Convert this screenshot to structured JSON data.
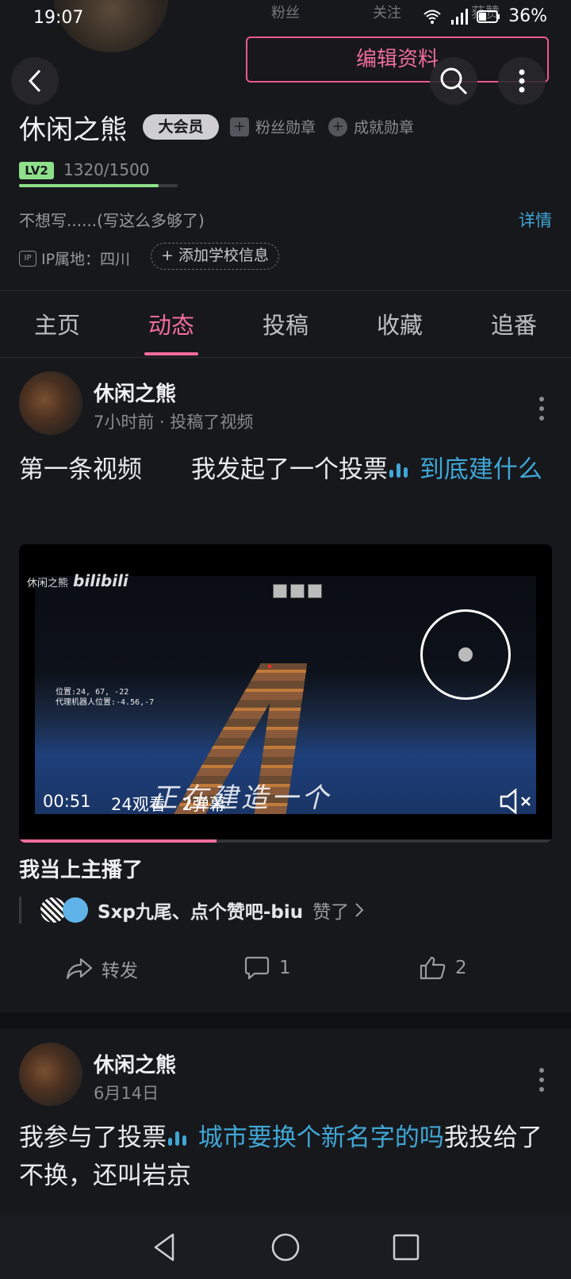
{
  "status_bar": {
    "time": "19:07",
    "battery": "36%"
  },
  "profile_top": {
    "fans_label": "粉丝",
    "follow_label": "关注",
    "likes_label": "获赞"
  },
  "edit_button": "编辑资料",
  "profile": {
    "name": "休闲之熊",
    "vip": "大会员",
    "fan_badge": "粉丝勋章",
    "achievement_badge": "成就勋章",
    "level": "LV2",
    "exp": "1320/1500",
    "exp_progress": 0.88,
    "bio": "不想写......(写这么多够了)",
    "detail": "详情",
    "ip_label": "IP属地：四川",
    "add_school": "+ 添加学校信息"
  },
  "tabs": [
    {
      "label": "主页",
      "active": false
    },
    {
      "label": "动态",
      "active": true
    },
    {
      "label": "投稿",
      "active": false
    },
    {
      "label": "收藏",
      "active": false
    },
    {
      "label": "追番",
      "active": false
    }
  ],
  "posts": [
    {
      "author": "休闲之熊",
      "meta": "7小时前 · 投稿了视频",
      "text_plain": "第一条视频　　我发起了一个投票",
      "text_link": "到底建什么",
      "video": {
        "channel": "休闲之熊",
        "logo": "bilibili",
        "coord_line1": "位置:24, 67, -22",
        "coord_line2": "代理机器人位置:-4.56,-7",
        "duration": "00:51",
        "views": "24观看",
        "danmaku": "2弹幕",
        "watermark": "正在建造一个",
        "progress": 0.37
      },
      "video_title": "我当上主播了",
      "liked_by": "Sxp九尾、点个赞吧-biu",
      "liked_suffix": "赞了",
      "actions": {
        "forward": "转发",
        "comments": "1",
        "likes": "2"
      }
    },
    {
      "author": "休闲之熊",
      "meta": "6月14日",
      "text_prefix": "我参与了投票",
      "text_link": "城市要换个新名字的吗",
      "text_suffix": "我投给了不换，还叫岩京"
    }
  ],
  "colors": {
    "accent": "#f06d9b",
    "link": "#3fa7d6",
    "background": "#17181c"
  }
}
